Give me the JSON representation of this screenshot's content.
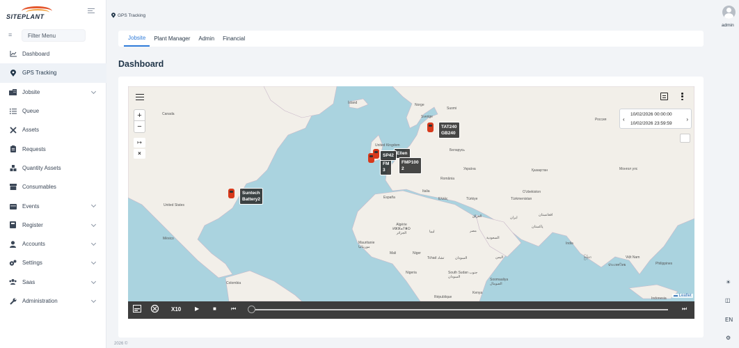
{
  "app": {
    "logo_text": "SITEPLANT"
  },
  "sidebar": {
    "filter_placeholder": "Filter Menu",
    "items": [
      {
        "label": "Dashboard",
        "icon": "chart-line-icon"
      },
      {
        "label": "GPS Tracking",
        "icon": "map-pin-icon",
        "active": true
      },
      {
        "label": "Jobsite",
        "icon": "building-icon",
        "expandable": true
      },
      {
        "label": "Queue",
        "icon": "list-icon"
      },
      {
        "label": "Assets",
        "icon": "tools-icon"
      },
      {
        "label": "Requests",
        "icon": "clipboard-icon"
      },
      {
        "label": "Quantity Assets",
        "icon": "cubes-icon"
      },
      {
        "label": "Consumables",
        "icon": "box-icon"
      },
      {
        "label": "Events",
        "icon": "calendar-icon",
        "expandable": true
      },
      {
        "label": "Register",
        "icon": "register-icon",
        "expandable": true
      },
      {
        "label": "Accounts",
        "icon": "user-icon",
        "expandable": true
      },
      {
        "label": "Settings",
        "icon": "cogs-icon",
        "expandable": true
      },
      {
        "label": "Saas",
        "icon": "users-icon",
        "expandable": true
      },
      {
        "label": "Administration",
        "icon": "wrench-icon",
        "expandable": true
      }
    ]
  },
  "breadcrumb": {
    "label": "GPS Tracking"
  },
  "tabs": [
    {
      "label": "Jobsite",
      "active": true
    },
    {
      "label": "Plant Manager"
    },
    {
      "label": "Admin"
    },
    {
      "label": "Financial"
    }
  ],
  "page": {
    "title": "Dashboard"
  },
  "map": {
    "date_from": "10/02/2026 00:00:00",
    "date_to": "10/02/2026 23:59:59",
    "attribution": "Leaflet",
    "labels": {
      "island": "Ísland",
      "norge": "Norge",
      "sverige": "Sverige",
      "suomi": "Suomi",
      "canada": "Canada",
      "united_states": "United States",
      "mexico": "México",
      "colombia": "Colombia",
      "uk": "United Kingdom",
      "belarus": "Беларусь",
      "ukraine": "Україна",
      "romania": "România",
      "italia": "Italia",
      "espana": "España",
      "ellas": "Ελλάς",
      "turkiye": "Türkiye",
      "kazakhstan": "Қазақстан",
      "uzbekistan": "Oʻzbekiston",
      "turkmenistan": "Türkmenistan",
      "mongolia": "Монгол улс",
      "russia": "Россия",
      "algerie": "Algérie ⵍⵣⵣⴰⵢⴻⵔ الجزائر",
      "libya": "ليبيا",
      "egypt": "مصر",
      "mauritanie": "Mauritanie موريتانيا",
      "mali": "Mali",
      "niger": "Niger",
      "tchad": "Tchad تشاد",
      "sudan": "السودان",
      "nigeria": "Nigeria",
      "south_sudan": "South Sudan جنوب السودان",
      "somalia": "Soomaaliya الصومال",
      "kenya": "Kenya",
      "rdc": "République",
      "iraq": "العراق",
      "iran": "ایران",
      "saudi": "السعودية",
      "yemen": "اليمن",
      "afghanistan": "افغانستان",
      "pakistan": "پاکستان",
      "india": "India",
      "myanmar": "မြန်မာ",
      "thailand": "ประเทศไทย",
      "vietnam": "Việt Nam",
      "philippines": "Philippines",
      "indonesia": "Indonesia"
    },
    "vehicles": [
      {
        "label_line1": "TAT240",
        "label_line2": "GB240"
      },
      {
        "label_line1": "SP42",
        "label_line2": ""
      },
      {
        "label_line1": "Ellen",
        "label_line2": ""
      },
      {
        "label_line1": "FMP100",
        "label_line2": "2"
      },
      {
        "label_line1": "FM",
        "label_line2": "3"
      },
      {
        "label_line1": "Suntech",
        "label_line2": "Battery2"
      }
    ]
  },
  "playback": {
    "speed": "X10"
  },
  "footer": {
    "text": "2026 ©"
  },
  "rail": {
    "username": "admin",
    "language": "EN"
  }
}
